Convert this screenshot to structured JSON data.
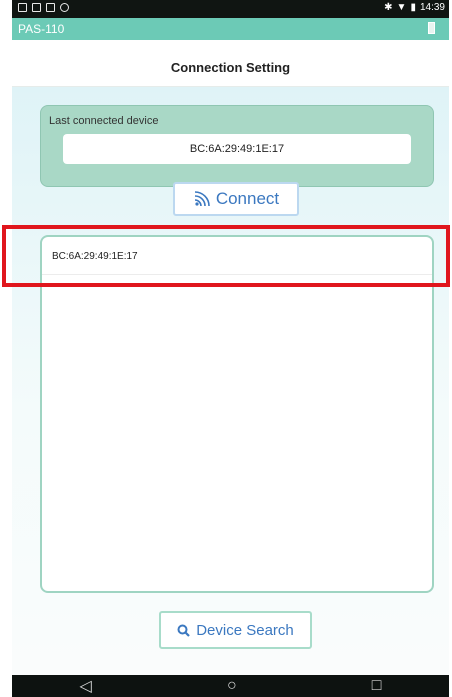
{
  "status_bar": {
    "time": "14:39",
    "icons_left": [
      "image-icon",
      "image-icon",
      "sd-card-icon",
      "android-icon"
    ],
    "icons_right": [
      "bluetooth-icon",
      "wifi-icon",
      "battery-icon"
    ]
  },
  "app": {
    "title": "PAS-110"
  },
  "header": {
    "title": "Connection Setting"
  },
  "last_connected": {
    "label": "Last connected device",
    "value": "BC:6A:29:49:1E:17"
  },
  "connect_button": {
    "label": "Connect",
    "icon": "signal-waves-icon"
  },
  "device_list": {
    "items": [
      {
        "address": "BC:6A:29:49:1E:17"
      }
    ]
  },
  "search_button": {
    "label": "Device Search",
    "icon": "search-icon"
  },
  "nav_bar": {
    "back_glyph": "◁",
    "home_glyph": "○",
    "recents_glyph": "□"
  },
  "colors": {
    "accent": "#6ccab6",
    "highlight": "#e0161d",
    "button_text": "#3b78c0"
  }
}
